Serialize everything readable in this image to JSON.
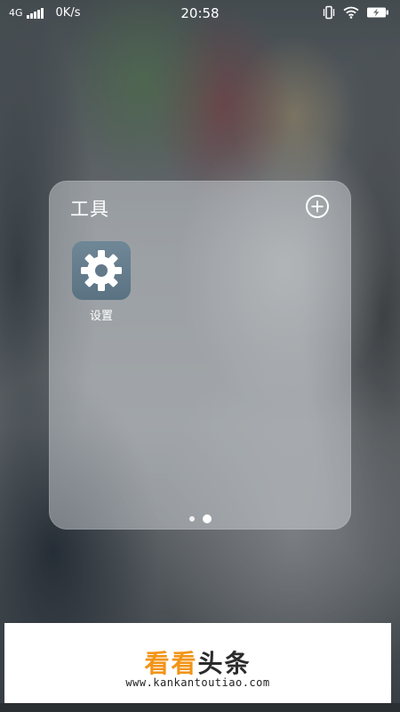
{
  "status_bar": {
    "network_type": "4G",
    "net_speed": "0K/s",
    "time": "20:58",
    "icons": [
      "vibrate-icon",
      "wifi-icon",
      "battery-charging-icon"
    ]
  },
  "folder": {
    "title": "工具",
    "add_icon": "plus-circle-icon",
    "apps": [
      {
        "label": "设置",
        "icon": "gear-icon"
      }
    ],
    "pages_total": 2,
    "current_page": 2
  },
  "watermark": {
    "brand_part1": "看看",
    "brand_part2": "头条",
    "url": "www.kankantoutiao.com",
    "colors": {
      "orange": "#f29418",
      "dark": "#2b2b2b"
    }
  }
}
